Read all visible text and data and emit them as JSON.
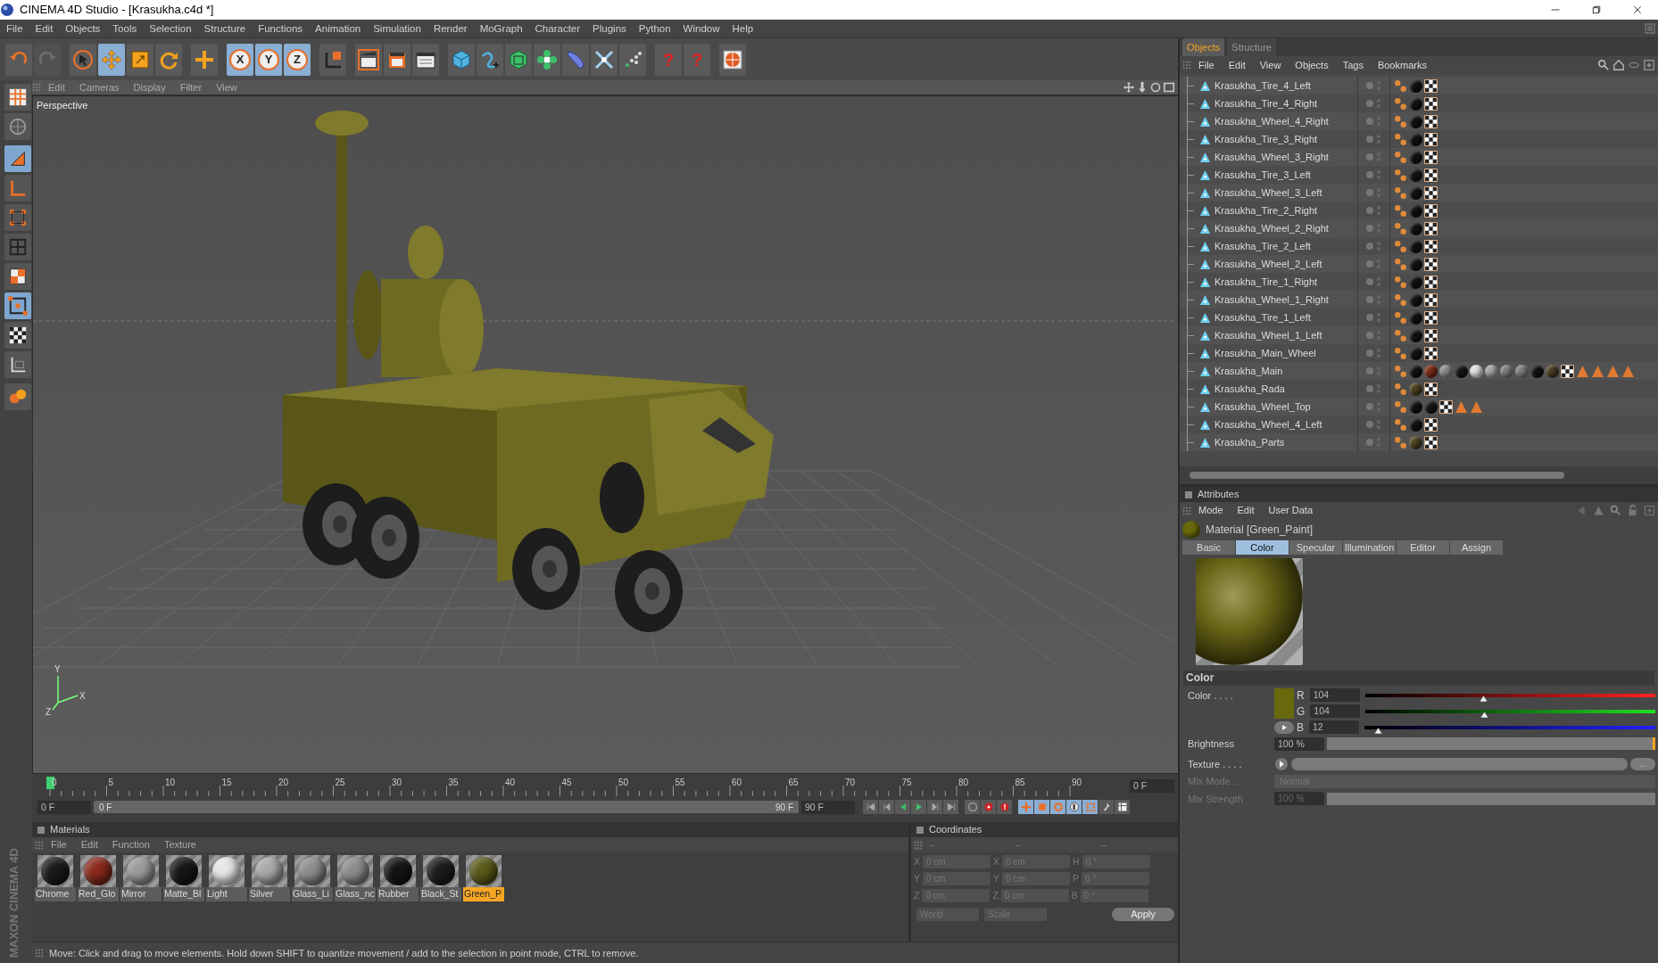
{
  "window": {
    "title": "CINEMA 4D Studio - [Krasukha.c4d *]"
  },
  "menu": [
    "File",
    "Edit",
    "Objects",
    "Tools",
    "Selection",
    "Structure",
    "Functions",
    "Animation",
    "Simulation",
    "Render",
    "MoGraph",
    "Character",
    "Plugins",
    "Python",
    "Window",
    "Help"
  ],
  "toolbar": [
    {
      "active": false,
      "disabled": false
    },
    {
      "active": false,
      "disabled": true
    },
    {
      "active": false,
      "disabled": false
    },
    {
      "active": true,
      "disabled": false
    },
    {
      "active": false,
      "disabled": false
    },
    {
      "active": false,
      "disabled": false
    },
    {
      "active": false,
      "disabled": false
    },
    {
      "active": true,
      "disabled": false,
      "label": "X"
    },
    {
      "active": true,
      "disabled": false,
      "label": "Y"
    },
    {
      "active": true,
      "disabled": false,
      "label": "Z"
    },
    {
      "active": false,
      "disabled": false
    },
    {
      "active": false,
      "disabled": false
    },
    {
      "active": false,
      "disabled": false
    },
    {
      "active": false,
      "disabled": false
    },
    {
      "active": false,
      "disabled": false
    },
    {
      "active": false,
      "disabled": false
    },
    {
      "active": false,
      "disabled": false
    },
    {
      "active": false,
      "disabled": false
    },
    {
      "active": false,
      "disabled": false
    },
    {
      "active": false,
      "disabled": false
    },
    {
      "active": false,
      "disabled": false
    },
    {
      "active": false,
      "disabled": false,
      "label": "?"
    },
    {
      "active": false,
      "disabled": false,
      "label": "?"
    },
    {
      "active": false,
      "disabled": false
    }
  ],
  "left_tools": [
    {
      "active": false
    },
    {
      "active": false
    },
    {
      "active": true
    },
    {
      "active": false
    },
    {
      "active": false
    },
    {
      "active": false
    },
    {
      "active": false
    },
    {
      "active": true
    },
    {
      "active": false
    },
    {
      "active": false
    },
    {
      "active": false
    }
  ],
  "logo": "MAXON CINEMA 4D",
  "viewport": {
    "menu": [
      "Edit",
      "Cameras",
      "Display",
      "Filter",
      "View"
    ],
    "camera": "Perspective",
    "axis_labels": [
      "Y",
      "X",
      "Z"
    ]
  },
  "timeline": {
    "ruler": [
      "0",
      "5",
      "10",
      "15",
      "20",
      "25",
      "30",
      "35",
      "40",
      "45",
      "50",
      "55",
      "60",
      "65",
      "70",
      "75",
      "80",
      "85",
      "90"
    ],
    "playhead": {
      "level": 0
    },
    "current_frame": "0 F",
    "start": "0 F",
    "range": {
      "level": 1,
      "start": "0 F",
      "end": "90 F"
    },
    "end": "90 F"
  },
  "materials": {
    "title": "Materials",
    "menu": [
      "File",
      "Edit",
      "Function",
      "Texture"
    ],
    "items": [
      {
        "name": "Chrome",
        "color": "#1a1a1a",
        "selected": false
      },
      {
        "name": "Red_Glo",
        "color": "#8a2a1c",
        "selected": false
      },
      {
        "name": "Mirror",
        "color": "#9a9a9a",
        "selected": false
      },
      {
        "name": "Matte_Bl",
        "color": "#161616",
        "selected": false
      },
      {
        "name": "Light",
        "color": "#e6e6e6",
        "selected": false
      },
      {
        "name": "Silver",
        "color": "#a8a8a8",
        "selected": false
      },
      {
        "name": "Glass_Li",
        "color": "#8c8c8c",
        "selected": false
      },
      {
        "name": "Glass_nc",
        "color": "#8c8c8c",
        "selected": false
      },
      {
        "name": "Rubber",
        "color": "#141414",
        "selected": false
      },
      {
        "name": "Black_St",
        "color": "#1c1c1c",
        "selected": false
      },
      {
        "name": "Green_P",
        "color": "#5a5a1a",
        "selected": true
      }
    ]
  },
  "coordinates": {
    "title": "Coordinates",
    "column_heads": [
      "–",
      "–",
      "–"
    ],
    "rows": [
      {
        "axis": "X",
        "position": "0 cm",
        "axis_2": "X",
        "size": "0 cm",
        "axis_3": "H",
        "rotation": "0 °"
      },
      {
        "axis": "Y",
        "position": "0 cm",
        "axis_2": "Y",
        "size": "0 cm",
        "axis_3": "P",
        "rotation": "0 °"
      },
      {
        "axis": "Z",
        "position": "0 cm",
        "axis_2": "Z",
        "size": "0 cm",
        "axis_3": "B",
        "rotation": "0 °"
      }
    ],
    "space": "World",
    "mode": "Scale",
    "apply": "Apply"
  },
  "status_bar": "Move: Click and drag to move elements. Hold down SHIFT to quantize movement / add to the selection in point mode, CTRL to remove.",
  "objects": {
    "tabs": [
      {
        "label": "Objects",
        "selected": true
      },
      {
        "label": "Structure",
        "selected": false
      }
    ],
    "menu": [
      "File",
      "Edit",
      "View",
      "Objects",
      "Tags",
      "Bookmarks"
    ],
    "rows": [
      {
        "name": "Krasukha_Tire_4_Left",
        "tags": [
          {
            "kind": "phong"
          },
          {
            "kind": "material",
            "color": "#111111"
          },
          {
            "kind": "uvw"
          }
        ]
      },
      {
        "name": "Krasukha_Tire_4_Right",
        "tags": [
          {
            "kind": "phong"
          },
          {
            "kind": "material",
            "color": "#111111"
          },
          {
            "kind": "uvw"
          }
        ]
      },
      {
        "name": "Krasukha_Wheel_4_Right",
        "tags": [
          {
            "kind": "phong"
          },
          {
            "kind": "material",
            "color": "#111111"
          },
          {
            "kind": "uvw"
          }
        ]
      },
      {
        "name": "Krasukha_Tire_3_Right",
        "tags": [
          {
            "kind": "phong"
          },
          {
            "kind": "material",
            "color": "#111111"
          },
          {
            "kind": "uvw"
          }
        ]
      },
      {
        "name": "Krasukha_Wheel_3_Right",
        "tags": [
          {
            "kind": "phong"
          },
          {
            "kind": "material",
            "color": "#111111"
          },
          {
            "kind": "uvw"
          }
        ]
      },
      {
        "name": "Krasukha_Tire_3_Left",
        "tags": [
          {
            "kind": "phong"
          },
          {
            "kind": "material",
            "color": "#111111"
          },
          {
            "kind": "uvw"
          }
        ]
      },
      {
        "name": "Krasukha_Wheel_3_Left",
        "tags": [
          {
            "kind": "phong"
          },
          {
            "kind": "material",
            "color": "#111111"
          },
          {
            "kind": "uvw"
          }
        ]
      },
      {
        "name": "Krasukha_Tire_2_Right",
        "tags": [
          {
            "kind": "phong"
          },
          {
            "kind": "material",
            "color": "#111111"
          },
          {
            "kind": "uvw"
          }
        ]
      },
      {
        "name": "Krasukha_Wheel_2_Right",
        "tags": [
          {
            "kind": "phong"
          },
          {
            "kind": "material",
            "color": "#111111"
          },
          {
            "kind": "uvw"
          }
        ]
      },
      {
        "name": "Krasukha_Tire_2_Left",
        "tags": [
          {
            "kind": "phong"
          },
          {
            "kind": "material",
            "color": "#111111"
          },
          {
            "kind": "uvw"
          }
        ]
      },
      {
        "name": "Krasukha_Wheel_2_Left",
        "tags": [
          {
            "kind": "phong"
          },
          {
            "kind": "material",
            "color": "#111111"
          },
          {
            "kind": "uvw"
          }
        ]
      },
      {
        "name": "Krasukha_Tire_1_Right",
        "tags": [
          {
            "kind": "phong"
          },
          {
            "kind": "material",
            "color": "#111111"
          },
          {
            "kind": "uvw"
          }
        ]
      },
      {
        "name": "Krasukha_Wheel_1_Right",
        "tags": [
          {
            "kind": "phong"
          },
          {
            "kind": "material",
            "color": "#111111"
          },
          {
            "kind": "uvw"
          }
        ]
      },
      {
        "name": "Krasukha_Tire_1_Left",
        "tags": [
          {
            "kind": "phong"
          },
          {
            "kind": "material",
            "color": "#111111"
          },
          {
            "kind": "uvw"
          }
        ]
      },
      {
        "name": "Krasukha_Wheel_1_Left",
        "tags": [
          {
            "kind": "phong"
          },
          {
            "kind": "material",
            "color": "#111111"
          },
          {
            "kind": "uvw"
          }
        ]
      },
      {
        "name": "Krasukha_Main_Wheel",
        "tags": [
          {
            "kind": "phong"
          },
          {
            "kind": "material",
            "color": "#111111"
          },
          {
            "kind": "uvw"
          }
        ]
      },
      {
        "name": "Krasukha_Main",
        "tags": [
          {
            "kind": "phong"
          },
          {
            "kind": "material",
            "color": "#111111"
          },
          {
            "kind": "material",
            "color": "#7a2a18"
          },
          {
            "kind": "material",
            "color": "#8a8a8a"
          },
          {
            "kind": "material",
            "color": "#151515"
          },
          {
            "kind": "material",
            "color": "#e0e0e0"
          },
          {
            "kind": "material",
            "color": "#a0a0a0"
          },
          {
            "kind": "material",
            "color": "#7c7c7c"
          },
          {
            "kind": "material",
            "color": "#7c7c7c"
          },
          {
            "kind": "material",
            "color": "#121212"
          },
          {
            "kind": "material",
            "color": "#4a3a22"
          },
          {
            "kind": "uvw"
          },
          {
            "kind": "selection"
          },
          {
            "kind": "selection"
          },
          {
            "kind": "selection"
          },
          {
            "kind": "selection"
          }
        ]
      },
      {
        "name": "Krasukha_Rada",
        "tags": [
          {
            "kind": "phong"
          },
          {
            "kind": "material",
            "color": "#4a4020"
          },
          {
            "kind": "uvw"
          }
        ]
      },
      {
        "name": "Krasukha_Wheel_Top",
        "tags": [
          {
            "kind": "phong"
          },
          {
            "kind": "material",
            "color": "#111111"
          },
          {
            "kind": "material",
            "color": "#151515"
          },
          {
            "kind": "uvw"
          },
          {
            "kind": "selection"
          },
          {
            "kind": "selection"
          }
        ]
      },
      {
        "name": "Krasukha_Wheel_4_Left",
        "tags": [
          {
            "kind": "phong"
          },
          {
            "kind": "material",
            "color": "#111111"
          },
          {
            "kind": "uvw"
          }
        ]
      },
      {
        "name": "Krasukha_Parts",
        "tags": [
          {
            "kind": "phong"
          },
          {
            "kind": "material",
            "color": "#4a4020"
          },
          {
            "kind": "uvw"
          }
        ]
      }
    ]
  },
  "attributes": {
    "title": "Attributes",
    "menu": [
      "Mode",
      "Edit",
      "User Data"
    ],
    "material": "Material [Green_Paint]",
    "tabs": [
      {
        "label": "Basic",
        "selected": false
      },
      {
        "label": "Color",
        "selected": true
      },
      {
        "label": "Specular",
        "selected": false
      },
      {
        "label": "Illumination",
        "selected": false
      },
      {
        "label": "Editor",
        "selected": false
      },
      {
        "label": "Assign",
        "selected": false
      }
    ],
    "section": "Color",
    "color": {
      "label": "Color . . . .",
      "channels": [
        {
          "name": "R",
          "value": "104",
          "level": 0.408
        },
        {
          "name": "G",
          "value": "104",
          "level": 0.408
        },
        {
          "name": "B",
          "value": "12",
          "level": 0.047
        }
      ]
    },
    "brightness": {
      "label": "Brightness",
      "value": "100 %",
      "level": 1
    },
    "texture": {
      "label": "Texture . . . .",
      "button": "..."
    },
    "mix_mode": {
      "label": "Mix Mode . .",
      "value": "Normal",
      "disabled": true
    },
    "mix_strength": {
      "label": "Mix Strength",
      "value": "100 %",
      "level": 1,
      "disabled": true
    }
  }
}
